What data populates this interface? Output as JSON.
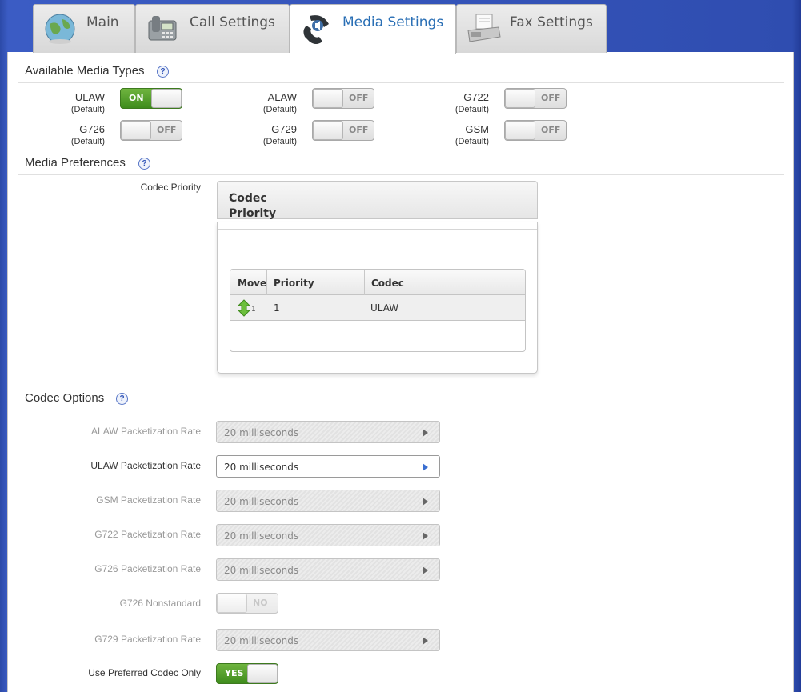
{
  "tabs": [
    {
      "label": "Main",
      "icon": "globe-icon"
    },
    {
      "label": "Call Settings",
      "icon": "telephone-icon"
    },
    {
      "label": "Media Settings",
      "icon": "phone-handset-icon"
    },
    {
      "label": "Fax Settings",
      "icon": "fax-machine-icon"
    }
  ],
  "active_tab": "Media Settings",
  "sections": {
    "available_media_types": {
      "title": "Available Media Types",
      "help": "?"
    },
    "media_preferences": {
      "title": "Media Preferences",
      "help": "?"
    },
    "codec_options": {
      "title": "Codec Options",
      "help": "?"
    }
  },
  "media_types": [
    {
      "name": "ULAW",
      "sub": "(Default)",
      "state": "ON"
    },
    {
      "name": "ALAW",
      "sub": "(Default)",
      "state": "OFF"
    },
    {
      "name": "G722",
      "sub": "(Default)",
      "state": "OFF"
    },
    {
      "name": "G726",
      "sub": "(Default)",
      "state": "OFF"
    },
    {
      "name": "G729",
      "sub": "(Default)",
      "state": "OFF"
    },
    {
      "name": "GSM",
      "sub": "(Default)",
      "state": "OFF"
    }
  ],
  "codec_priority": {
    "label": "Codec Priority",
    "header": "Codec Priority",
    "columns": [
      "Move",
      "Priority",
      "Codec"
    ],
    "rows": [
      {
        "move_index": "1",
        "priority": "1",
        "codec": "ULAW"
      }
    ]
  },
  "codec_options": [
    {
      "label": "ALAW Packetization Rate",
      "value": "20 milliseconds",
      "type": "select",
      "enabled": false
    },
    {
      "label": "ULAW Packetization Rate",
      "value": "20 milliseconds",
      "type": "select",
      "enabled": true
    },
    {
      "label": "GSM Packetization Rate",
      "value": "20 milliseconds",
      "type": "select",
      "enabled": false
    },
    {
      "label": "G722 Packetization Rate",
      "value": "20 milliseconds",
      "type": "select",
      "enabled": false
    },
    {
      "label": "G726 Packetization Rate",
      "value": "20 milliseconds",
      "type": "select",
      "enabled": false
    },
    {
      "label": "G726 Nonstandard",
      "value": "NO",
      "type": "toggle",
      "enabled": false
    },
    {
      "label": "G729 Packetization Rate",
      "value": "20 milliseconds",
      "type": "select",
      "enabled": false
    },
    {
      "label": "Use Preferred Codec Only",
      "value": "YES",
      "type": "toggle",
      "enabled": true
    }
  ],
  "colors": {
    "desktop": "#2f4db0",
    "active_tab_text": "#2a6fb5",
    "toggle_on": "#4f9a2a",
    "select_arrow_enabled": "#3b6fd1"
  }
}
